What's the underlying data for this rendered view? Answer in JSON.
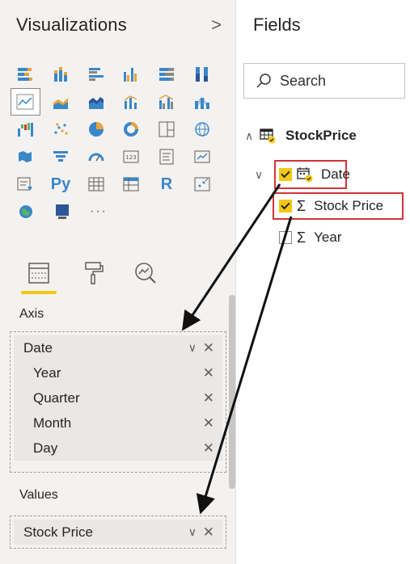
{
  "visualizations": {
    "title": "Visualizations",
    "collapse_glyph": ">",
    "more_glyph": "···",
    "selected_tool": "fields-well",
    "axis_label": "Axis",
    "axis_fields": [
      {
        "label": "Date",
        "level": 0,
        "expandable": true
      },
      {
        "label": "Year",
        "level": 1
      },
      {
        "label": "Quarter",
        "level": 1
      },
      {
        "label": "Month",
        "level": 1
      },
      {
        "label": "Day",
        "level": 1
      }
    ],
    "values_label": "Values",
    "value_fields": [
      {
        "label": "Stock Price",
        "expandable": true
      }
    ],
    "py_label": "Py",
    "r_label": "R",
    "remove_glyph": "✕",
    "caret_glyph": "∨"
  },
  "fields": {
    "title": "Fields",
    "search": {
      "placeholder": "Search",
      "value": ""
    },
    "table": {
      "name": "StockPrice",
      "expanded": true
    },
    "items": [
      {
        "label": "Date",
        "checked": true,
        "type": "date",
        "highlighted": true
      },
      {
        "label": "Stock Price",
        "checked": true,
        "type": "sum",
        "highlighted": true
      },
      {
        "label": "Year",
        "checked": false,
        "type": "sum",
        "highlighted": false
      }
    ],
    "sigma_glyph": "Σ"
  },
  "colors": {
    "accent_yellow": "#f2c811",
    "highlight_red": "#d13438",
    "pane_bg": "#f3f2f1",
    "icon_blue": "#3a87c8",
    "icon_orange": "#e8a33d"
  }
}
